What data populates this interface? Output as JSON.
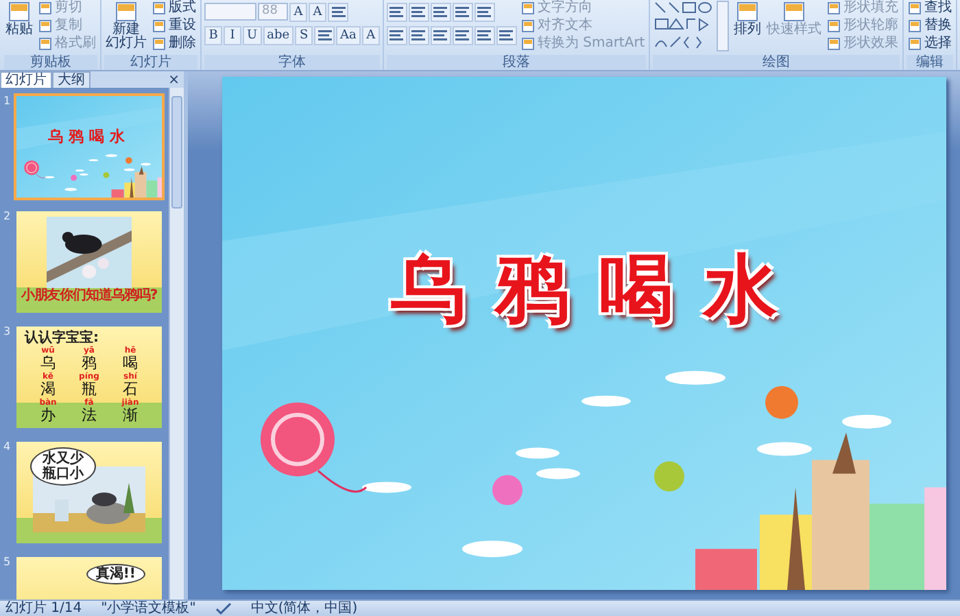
{
  "ribbon": {
    "groups": [
      {
        "label": "剪贴板",
        "columns": [
          [
            {
              "kind": "large",
              "lines": [
                "粘贴"
              ],
              "disabled": false
            }
          ],
          [
            {
              "kind": "small",
              "label": "剪切",
              "disabled": true
            },
            {
              "kind": "small",
              "label": "复制",
              "disabled": true
            },
            {
              "kind": "small",
              "label": "格式刷",
              "disabled": true
            }
          ]
        ]
      },
      {
        "label": "幻灯片",
        "columns": [
          [
            {
              "kind": "large",
              "lines": [
                "新建",
                "幻灯片"
              ],
              "disabled": false
            }
          ],
          [
            {
              "kind": "small",
              "label": "版式",
              "disabled": false
            },
            {
              "kind": "small",
              "label": "重设",
              "disabled": false
            },
            {
              "kind": "small",
              "label": "删除",
              "disabled": false
            }
          ]
        ]
      },
      {
        "label": "字体",
        "columns": [
          [
            {
              "kind": "row",
              "items": [
                {
                  "kind": "field"
                },
                {
                  "kind": "field",
                  "value": "88"
                },
                {
                  "kind": "glyph",
                  "label": "A"
                },
                {
                  "kind": "glyph",
                  "label": "A"
                },
                {
                  "kind": "tool"
                }
              ]
            },
            {
              "kind": "row",
              "items": [
                {
                  "kind": "glyph",
                  "label": "B"
                },
                {
                  "kind": "glyph",
                  "label": "I"
                },
                {
                  "kind": "glyph",
                  "label": "U"
                },
                {
                  "kind": "glyph",
                  "label": "abe"
                },
                {
                  "kind": "glyph",
                  "label": "S"
                },
                {
                  "kind": "tool"
                },
                {
                  "kind": "glyph",
                  "label": "Aa"
                },
                {
                  "kind": "glyph",
                  "label": "A"
                }
              ]
            }
          ]
        ]
      },
      {
        "label": "段落",
        "columns": [
          [
            {
              "kind": "row",
              "items": [
                {
                  "kind": "tool"
                },
                {
                  "kind": "tool"
                },
                {
                  "kind": "tool"
                },
                {
                  "kind": "tool"
                },
                {
                  "kind": "tool"
                }
              ]
            },
            {
              "kind": "row",
              "items": [
                {
                  "kind": "tool"
                },
                {
                  "kind": "tool"
                },
                {
                  "kind": "tool"
                },
                {
                  "kind": "tool"
                },
                {
                  "kind": "tool"
                },
                {
                  "kind": "tool"
                }
              ]
            }
          ],
          [
            {
              "kind": "small",
              "label": "文字方向",
              "disabled": true
            },
            {
              "kind": "small",
              "label": "对齐文本",
              "disabled": true
            },
            {
              "kind": "small",
              "label": "转换为 SmartArt",
              "disabled": true
            }
          ]
        ]
      },
      {
        "label": "绘图",
        "columns": [
          [
            {
              "kind": "gallery"
            }
          ],
          [
            {
              "kind": "large",
              "lines": [
                "排列"
              ],
              "disabled": false
            }
          ],
          [
            {
              "kind": "large",
              "lines": [
                "快速样式"
              ],
              "disabled": true
            }
          ],
          [
            {
              "kind": "small",
              "label": "形状填充",
              "disabled": true
            },
            {
              "kind": "small",
              "label": "形状轮廓",
              "disabled": true
            },
            {
              "kind": "small",
              "label": "形状效果",
              "disabled": true
            }
          ]
        ]
      },
      {
        "label": "编辑",
        "columns": [
          [
            {
              "kind": "small",
              "label": "查找",
              "disabled": false
            },
            {
              "kind": "small",
              "label": "替换",
              "disabled": false
            },
            {
              "kind": "small",
              "label": "选择",
              "disabled": false
            }
          ]
        ]
      }
    ]
  },
  "panel": {
    "tabs": [
      {
        "label": "幻灯片",
        "selected": true
      },
      {
        "label": "大纲",
        "selected": false
      }
    ],
    "close": "×"
  },
  "slides": [
    {
      "number": "1",
      "kind": "title",
      "selected": true,
      "title": "乌鸦喝水"
    },
    {
      "number": "2",
      "selected": false,
      "caption": "小朋友你们知道乌鸦吗?"
    },
    {
      "number": "3",
      "kind": "characters",
      "selected": false,
      "heading": "认认字宝宝:",
      "characters": [
        {
          "pinyin": "wū",
          "text": "乌"
        },
        {
          "pinyin": "yā",
          "text": "鸦"
        },
        {
          "pinyin": "hē",
          "text": "喝"
        },
        {
          "pinyin": "kě",
          "text": "渴"
        },
        {
          "pinyin": "píng",
          "text": "瓶"
        },
        {
          "pinyin": "shí",
          "text": "石"
        },
        {
          "pinyin": "bàn",
          "text": "办"
        },
        {
          "pinyin": "fǎ",
          "text": "法"
        },
        {
          "pinyin": "jiàn",
          "text": "渐"
        }
      ]
    },
    {
      "number": "4",
      "kind": "bubble",
      "selected": false,
      "bubble": [
        "水又少",
        "瓶口小"
      ]
    },
    {
      "number": "5",
      "kind": "bubble",
      "selected": false,
      "bubble": [
        "真渴!!"
      ]
    }
  ],
  "slide": {
    "title": "乌鸦喝水"
  },
  "status_bar": {
    "slide": "幻灯片 1/14",
    "theme": "\"小学语文模板\"",
    "language": "中文(简体，中国)"
  }
}
